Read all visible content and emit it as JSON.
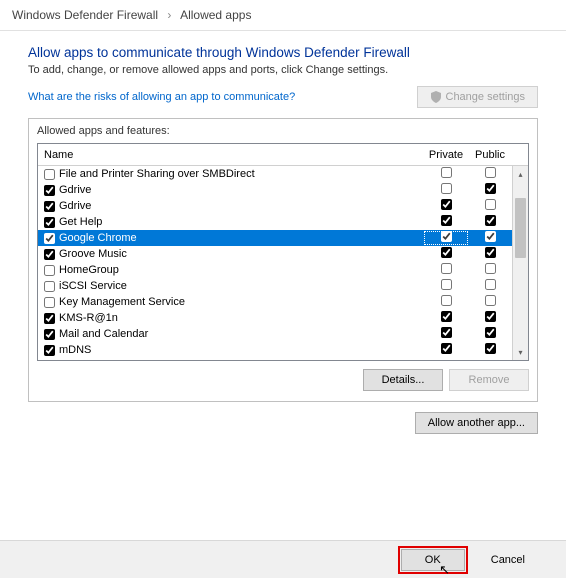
{
  "breadcrumb": {
    "root": "Windows Defender Firewall",
    "current": "Allowed apps"
  },
  "heading": "Allow apps to communicate through Windows Defender Firewall",
  "subheading": "To add, change, or remove allowed apps and ports, click Change settings.",
  "risk_link": "What are the risks of allowing an app to communicate?",
  "change_settings_label": "Change settings",
  "groupbox_label": "Allowed apps and features:",
  "columns": {
    "name": "Name",
    "private": "Private",
    "public": "Public"
  },
  "rows": [
    {
      "enabled": false,
      "name": "File and Printer Sharing over SMBDirect",
      "private": false,
      "public": false,
      "selected": false
    },
    {
      "enabled": true,
      "name": "Gdrive",
      "private": false,
      "public": true,
      "selected": false
    },
    {
      "enabled": true,
      "name": "Gdrive",
      "private": true,
      "public": false,
      "selected": false
    },
    {
      "enabled": true,
      "name": "Get Help",
      "private": true,
      "public": true,
      "selected": false
    },
    {
      "enabled": true,
      "name": "Google Chrome",
      "private": true,
      "public": true,
      "selected": true
    },
    {
      "enabled": true,
      "name": "Groove Music",
      "private": true,
      "public": true,
      "selected": false
    },
    {
      "enabled": false,
      "name": "HomeGroup",
      "private": false,
      "public": false,
      "selected": false
    },
    {
      "enabled": false,
      "name": "iSCSI Service",
      "private": false,
      "public": false,
      "selected": false
    },
    {
      "enabled": false,
      "name": "Key Management Service",
      "private": false,
      "public": false,
      "selected": false
    },
    {
      "enabled": true,
      "name": "KMS-R@1n",
      "private": true,
      "public": true,
      "selected": false
    },
    {
      "enabled": true,
      "name": "Mail and Calendar",
      "private": true,
      "public": true,
      "selected": false
    },
    {
      "enabled": true,
      "name": "mDNS",
      "private": true,
      "public": true,
      "selected": false
    }
  ],
  "buttons": {
    "details": "Details...",
    "remove": "Remove",
    "allow_another": "Allow another app...",
    "ok": "OK",
    "cancel": "Cancel"
  }
}
